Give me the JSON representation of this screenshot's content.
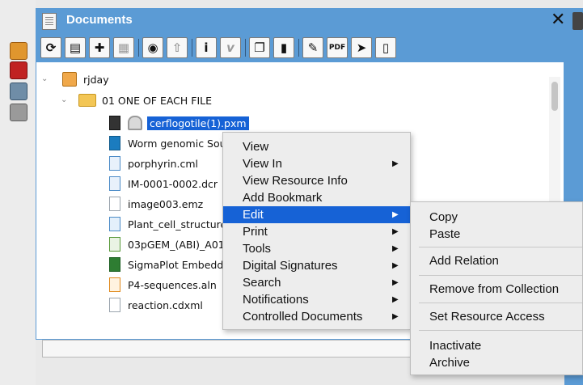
{
  "window": {
    "title": "Documents"
  },
  "toolbar": {
    "buttons": [
      "sync-icon",
      "add-document-icon",
      "add-icon",
      "clipboard-list-icon",
      "view-icon",
      "upload-icon",
      "info-icon",
      "italic-v-icon",
      "copy-icon",
      "paste-icon",
      "pin-icon",
      "pdf-icon",
      "send-icon",
      "book-icon"
    ]
  },
  "tree": {
    "root": "rjday",
    "folder": "01 ONE OF EACH FILE",
    "files": [
      {
        "name": "cerflogotile(1).pxm",
        "type": "pxm"
      },
      {
        "name": "Worm genomic Sout",
        "type": "doc"
      },
      {
        "name": "porphyrin.cml",
        "type": "cml"
      },
      {
        "name": "IM-0001-0002.dcr",
        "type": "dcm"
      },
      {
        "name": "image003.emz",
        "type": "emz"
      },
      {
        "name": "Plant_cell_structure_",
        "type": "svg"
      },
      {
        "name": "03pGEM_(ABI)_A01",
        "type": "ab1"
      },
      {
        "name": "SigmaPlot Embedde",
        "type": "xls"
      },
      {
        "name": "P4-sequences.aln",
        "type": "aln"
      },
      {
        "name": "reaction.cdxml",
        "type": "cdxml"
      }
    ]
  },
  "context_menu": {
    "items": [
      "View",
      "View In",
      "View Resource Info",
      "Add Bookmark",
      "Edit",
      "Print",
      "Tools",
      "Digital Signatures",
      "Search",
      "Notifications",
      "Controlled Documents"
    ],
    "active": "Edit"
  },
  "edit_submenu": {
    "items": [
      "Copy",
      "Paste",
      "Add Relation",
      "Remove from Collection",
      "Set Resource Access",
      "Inactivate",
      "Archive"
    ]
  },
  "colors": {
    "titlebar": "#5b9bd5",
    "selection": "#1662d6",
    "menu_bg": "#ededed"
  }
}
